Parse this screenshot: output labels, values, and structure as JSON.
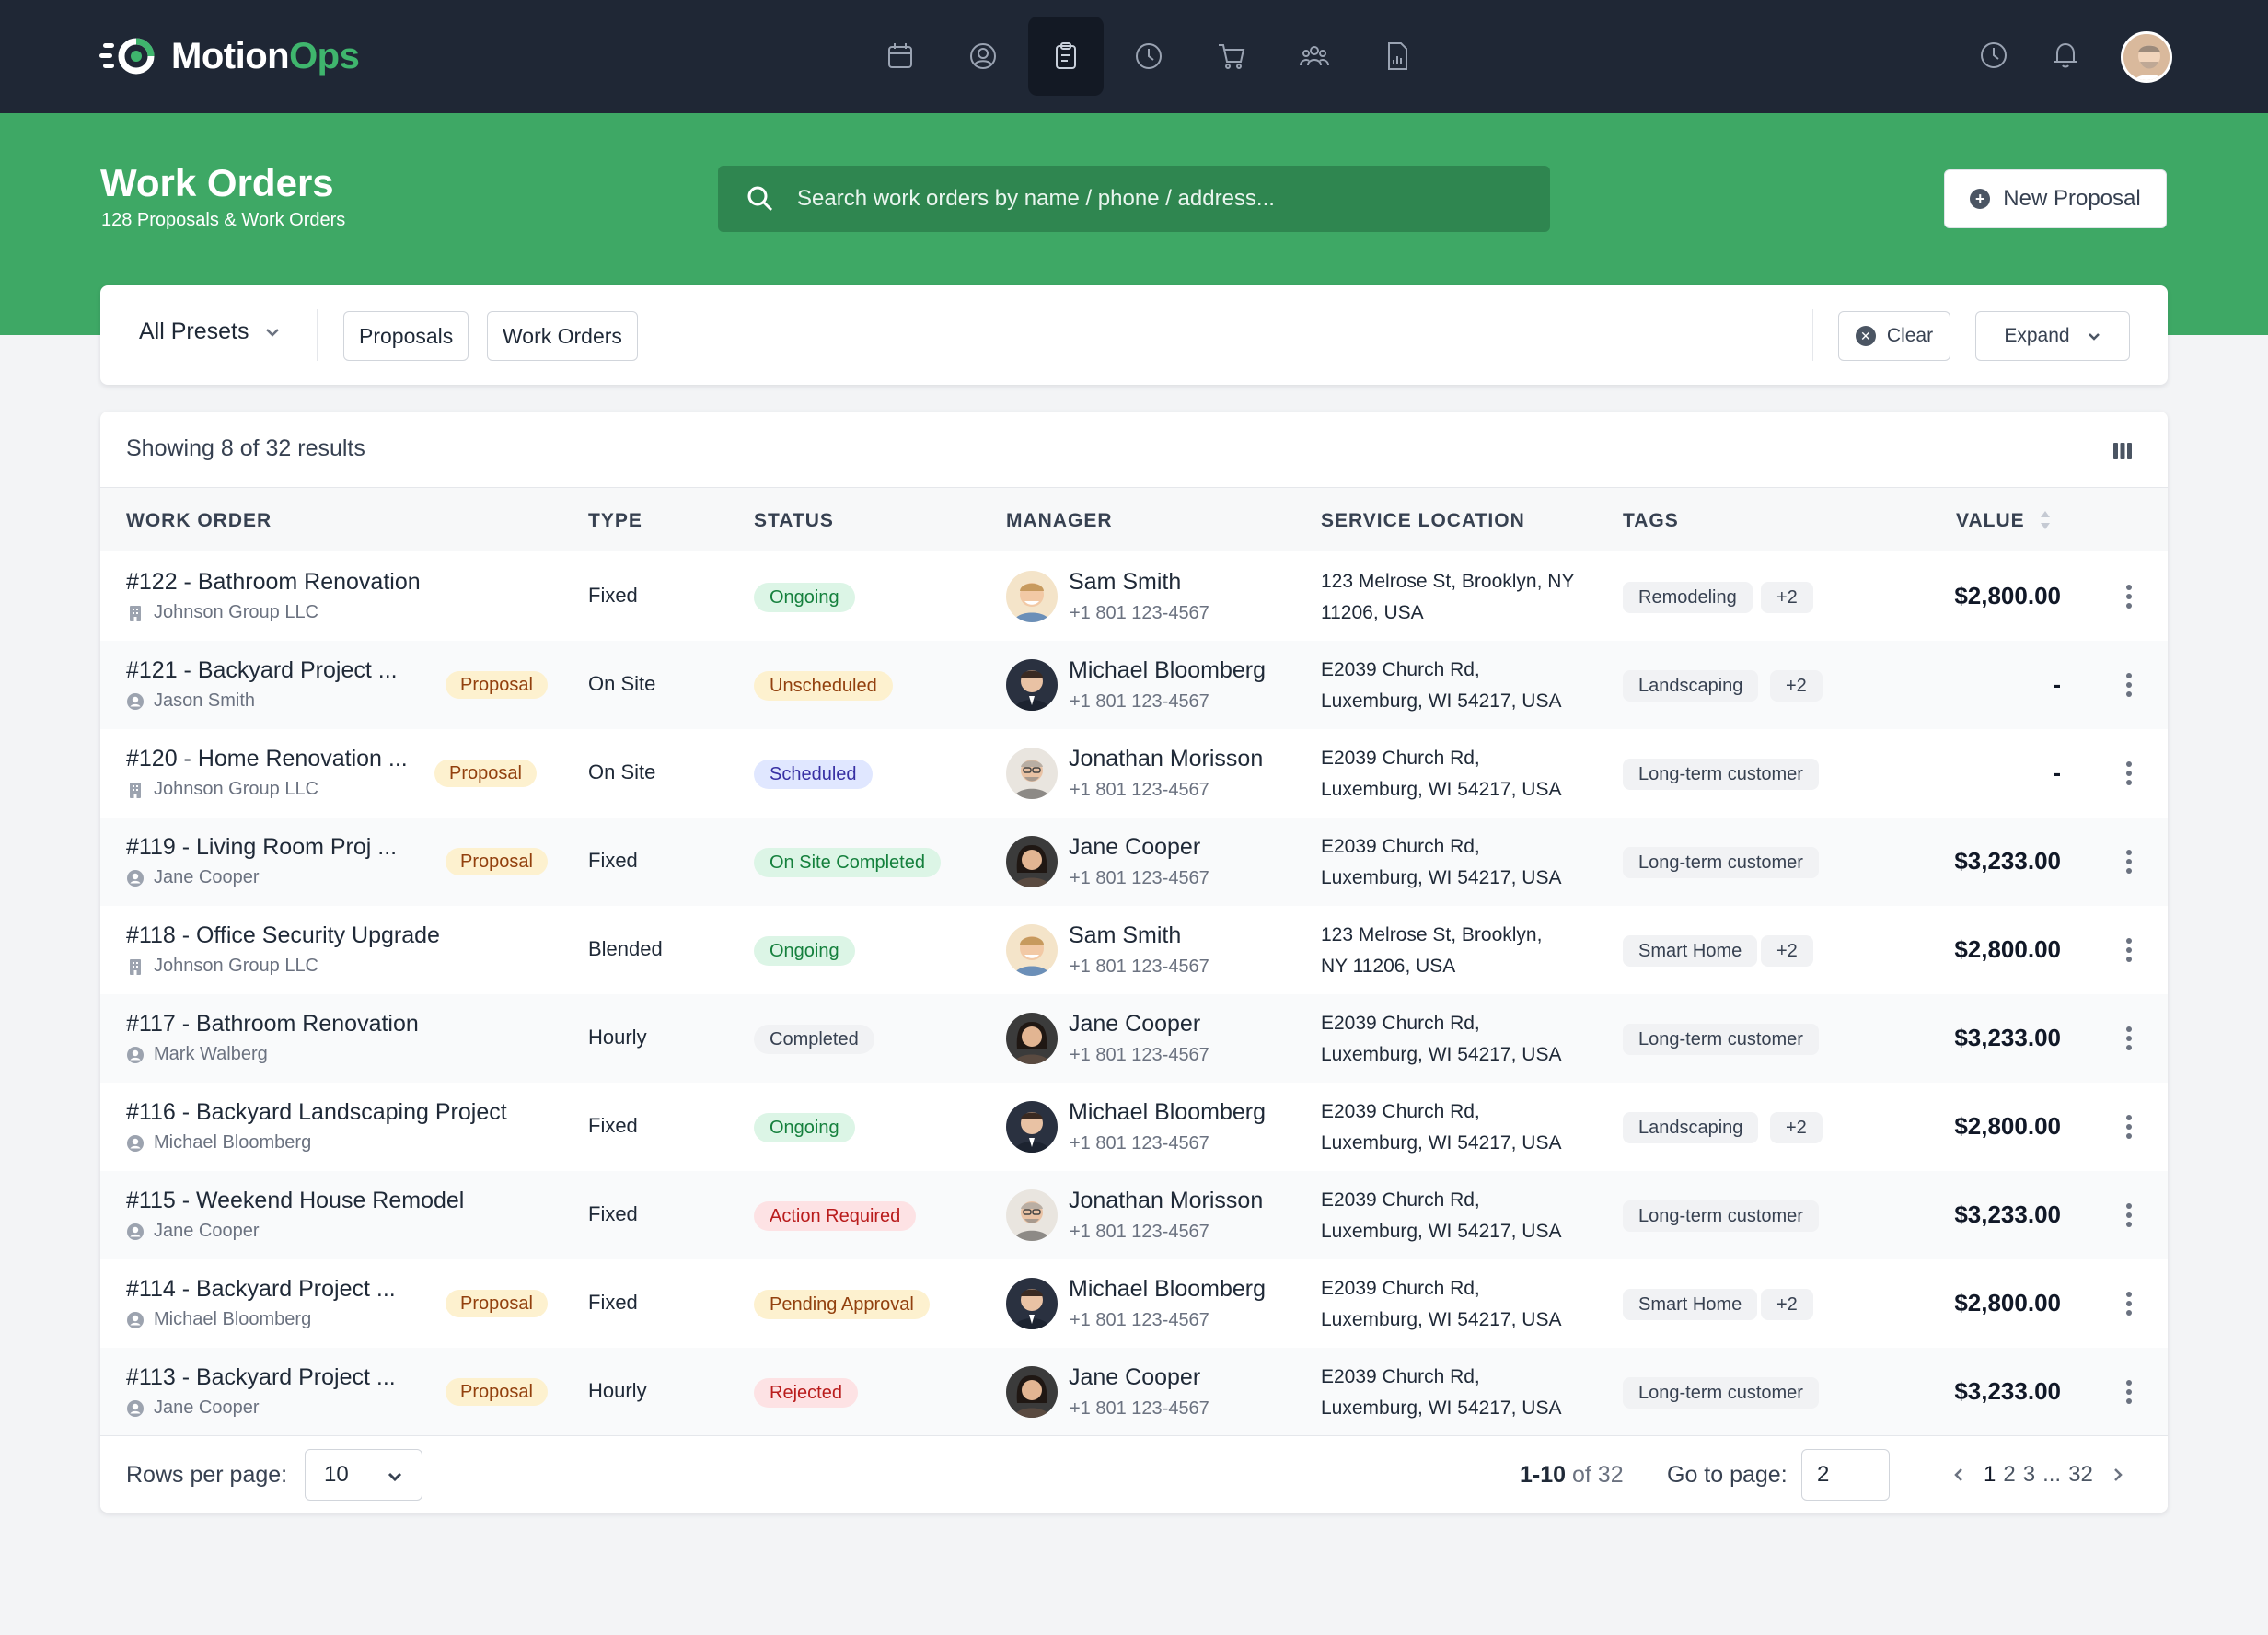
{
  "app": {
    "logo_text_1": "Motion",
    "logo_text_2": "Ops",
    "brand_color": "#3ea865",
    "nav_icons": [
      "calendar-icon",
      "user-circle-icon",
      "clipboard-icon",
      "clock-icon",
      "cart-icon",
      "team-icon",
      "report-icon"
    ],
    "active_nav": "clipboard-icon"
  },
  "header": {
    "title": "Work Orders",
    "subtitle": "128 Proposals & Work Orders",
    "search_placeholder": "Search work orders by name / phone / address...",
    "new_button": "New Proposal"
  },
  "filters": {
    "presets": "All Presets",
    "proposals": "Proposals",
    "work_orders": "Work Orders",
    "clear": "Clear",
    "expand": "Expand"
  },
  "table": {
    "showing": "Showing 8 of 32 results",
    "columns": {
      "work_order": "WORK ORDER",
      "type": "TYPE",
      "status": "STATUS",
      "manager": "MANAGER",
      "location": "SERVICE LOCATION",
      "tags": "TAGS",
      "value": "VALUE"
    },
    "rows": [
      {
        "title": "#122 - Bathroom Renovation",
        "client": "Johnson Group LLC",
        "client_type": "company",
        "proposal": "",
        "type": "Fixed",
        "status": "Ongoing",
        "status_kind": "green",
        "manager": "Sam Smith",
        "manager_avatar": "sam",
        "phone": "+1 801 123-4567",
        "loc1": "123 Melrose St, Brooklyn, NY",
        "loc2": "11206, USA",
        "tag": "Remodeling",
        "tag_more": "+2",
        "value": "$2,800.00"
      },
      {
        "title": "#121 - Backyard Project ...",
        "client": "Jason Smith",
        "client_type": "person",
        "proposal": "Proposal",
        "type": "On Site",
        "status": "Unscheduled",
        "status_kind": "amber",
        "manager": "Michael Bloomberg",
        "manager_avatar": "michael",
        "phone": "+1 801 123-4567",
        "loc1": "E2039 Church Rd,",
        "loc2": "Luxemburg, WI 54217, USA",
        "tag": "Landscaping",
        "tag_more": "+2",
        "value": "-"
      },
      {
        "title": "#120 - Home Renovation ...",
        "client": "Johnson Group LLC",
        "client_type": "company",
        "proposal": "Proposal",
        "type": "On Site",
        "status": "Scheduled",
        "status_kind": "blue",
        "manager": "Jonathan Morisson",
        "manager_avatar": "jonathan",
        "phone": "+1 801 123-4567",
        "loc1": "E2039 Church Rd,",
        "loc2": "Luxemburg, WI 54217, USA",
        "tag": "Long-term customer",
        "tag_more": "",
        "value": "-"
      },
      {
        "title": "#119 - Living Room Proj ...",
        "client": "Jane Cooper",
        "client_type": "person",
        "proposal": "Proposal",
        "type": "Fixed",
        "status": "On Site Completed",
        "status_kind": "green",
        "manager": "Jane Cooper",
        "manager_avatar": "jane",
        "phone": "+1 801 123-4567",
        "loc1": "E2039 Church Rd,",
        "loc2": "Luxemburg, WI 54217, USA",
        "tag": "Long-term customer",
        "tag_more": "",
        "value": "$3,233.00"
      },
      {
        "title": "#118 - Office Security Upgrade",
        "client": "Johnson Group LLC",
        "client_type": "company",
        "proposal": "",
        "type": "Blended",
        "status": "Ongoing",
        "status_kind": "green",
        "manager": "Sam Smith",
        "manager_avatar": "sam",
        "phone": "+1 801 123-4567",
        "loc1": "123 Melrose St, Brooklyn,",
        "loc2": "NY 11206, USA",
        "tag": "Smart Home",
        "tag_more": "+2",
        "value": "$2,800.00"
      },
      {
        "title": "#117 - Bathroom Renovation",
        "client": "Mark Walberg",
        "client_type": "person",
        "proposal": "",
        "type": "Hourly",
        "status": "Completed",
        "status_kind": "gray",
        "manager": "Jane Cooper",
        "manager_avatar": "jane",
        "phone": "+1 801 123-4567",
        "loc1": "E2039 Church Rd,",
        "loc2": "Luxemburg, WI 54217, USA",
        "tag": "Long-term customer",
        "tag_more": "",
        "value": "$3,233.00"
      },
      {
        "title": "#116 - Backyard Landscaping Project",
        "client": "Michael Bloomberg",
        "client_type": "person",
        "proposal": "",
        "type": "Fixed",
        "status": "Ongoing",
        "status_kind": "green",
        "manager": "Michael Bloomberg",
        "manager_avatar": "michael",
        "phone": "+1 801 123-4567",
        "loc1": "E2039 Church Rd,",
        "loc2": "Luxemburg, WI 54217, USA",
        "tag": "Landscaping",
        "tag_more": "+2",
        "value": "$2,800.00"
      },
      {
        "title": "#115 - Weekend House Remodel",
        "client": "Jane Cooper",
        "client_type": "person",
        "proposal": "",
        "type": "Fixed",
        "status": "Action Required",
        "status_kind": "red",
        "manager": "Jonathan Morisson",
        "manager_avatar": "jonathan",
        "phone": "+1 801 123-4567",
        "loc1": "E2039 Church Rd,",
        "loc2": "Luxemburg, WI 54217, USA",
        "tag": "Long-term customer",
        "tag_more": "",
        "value": "$3,233.00"
      },
      {
        "title": "#114 - Backyard Project ...",
        "client": "Michael Bloomberg",
        "client_type": "person",
        "proposal": "Proposal",
        "type": "Fixed",
        "status": "Pending Approval",
        "status_kind": "amber",
        "manager": "Michael Bloomberg",
        "manager_avatar": "michael",
        "phone": "+1 801 123-4567",
        "loc1": "E2039 Church Rd,",
        "loc2": "Luxemburg, WI 54217, USA",
        "tag": "Smart Home",
        "tag_more": "+2",
        "value": "$2,800.00"
      },
      {
        "title": "#113 - Backyard Project ...",
        "client": "Jane Cooper",
        "client_type": "person",
        "proposal": "Proposal",
        "type": "Hourly",
        "status": "Rejected",
        "status_kind": "red",
        "manager": "Jane Cooper",
        "manager_avatar": "jane",
        "phone": "+1 801 123-4567",
        "loc1": "E2039 Church Rd,",
        "loc2": "Luxemburg, WI 54217, USA",
        "tag": "Long-term customer",
        "tag_more": "",
        "value": "$3,233.00"
      }
    ],
    "status_colors": {
      "green": {
        "bg": "#dcf5e6",
        "fg": "#15803d"
      },
      "amber": {
        "bg": "#fdf1cf",
        "fg": "#92400e"
      },
      "blue": {
        "bg": "#e0e7ff",
        "fg": "#3730a3"
      },
      "red": {
        "bg": "#fde2e4",
        "fg": "#b91c1c"
      },
      "gray": {
        "bg": "#f1f2f4",
        "fg": "#374151"
      }
    }
  },
  "footer": {
    "rows_per_page_label": "Rows per page:",
    "rows_per_page_value": "10",
    "range_bold": "1-10",
    "range_rest": " of 32",
    "goto_label": "Go to page:",
    "goto_value": "2",
    "pages": [
      "1",
      "2",
      "3",
      "...",
      "32"
    ]
  }
}
